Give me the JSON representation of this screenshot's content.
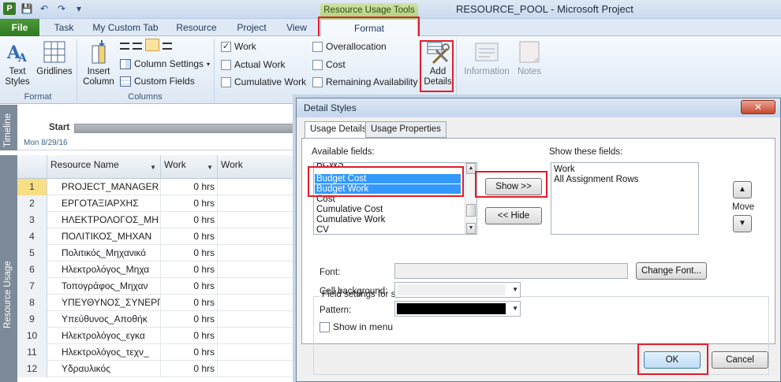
{
  "titlebar": {
    "tools_tab_title": "Resource Usage Tools",
    "app_title": "RESOURCE_POOL  -  Microsoft Project"
  },
  "tabs": [
    "File",
    "Task",
    "My Custom Tab",
    "Resource",
    "Project",
    "View",
    "Format"
  ],
  "ribbon": {
    "format_group": {
      "text_styles": "Text\nStyles",
      "gridlines": "Gridlines",
      "label": "Format"
    },
    "columns_group": {
      "insert_column": "Insert\nColumn",
      "column_settings": "Column Settings",
      "custom_fields": "Custom Fields",
      "label": "Columns"
    },
    "details": [
      {
        "label": "Work",
        "checked": true
      },
      {
        "label": "Actual Work",
        "checked": false
      },
      {
        "label": "Cumulative Work",
        "checked": false
      },
      {
        "label": "Overallocation",
        "checked": false
      },
      {
        "label": "Cost",
        "checked": false
      },
      {
        "label": "Remaining Availability",
        "checked": false
      }
    ],
    "add_details": "Add\nDetails",
    "information": "Information",
    "notes": "Notes"
  },
  "timeline": {
    "side_label": "Timeline",
    "start_label": "Start",
    "date_label": "Mon 8/29/16"
  },
  "grid": {
    "side_label": "Resource Usage",
    "columns": [
      "Resource Name",
      "Work",
      "Work"
    ],
    "rows": [
      {
        "id": "1",
        "name": "PROJECT_MANAGER",
        "work": "0 hrs"
      },
      {
        "id": "2",
        "name": "ΕΡΓΟΤΑΞΙΑΡΧΗΣ",
        "work": "0 hrs"
      },
      {
        "id": "3",
        "name": "ΗΛΕΚΤΡΟΛΟΓΟΣ_ΜΗ",
        "work": "0 hrs"
      },
      {
        "id": "4",
        "name": "ΠΟΛΙΤΙΚΟΣ_ΜΗΧΑΝ",
        "work": "0 hrs"
      },
      {
        "id": "5",
        "name": "Πολιτικός_Μηχανικό",
        "work": "0 hrs"
      },
      {
        "id": "6",
        "name": "Ηλεκτρολόγος_Μηχα",
        "work": "0 hrs"
      },
      {
        "id": "7",
        "name": "Τοπογράφος_Μηχαν",
        "work": "0 hrs"
      },
      {
        "id": "8",
        "name": "ΥΠΕΥΘΥΝΟΣ_ΣΥΝΕΡΓ",
        "work": "0 hrs"
      },
      {
        "id": "9",
        "name": "Υπεύθυνος_Αποθήκ",
        "work": "0 hrs"
      },
      {
        "id": "10",
        "name": "Ηλεκτρολόγος_εγκα",
        "work": "0 hrs"
      },
      {
        "id": "11",
        "name": "Ηλεκτρολόγος_τεχν_",
        "work": "0 hrs"
      },
      {
        "id": "12",
        "name": "Υδραυλικός",
        "work": "0 hrs"
      }
    ]
  },
  "dialog": {
    "title": "Detail Styles",
    "close": "✕",
    "tabs": [
      "Usage Details",
      "Usage Properties"
    ],
    "available_label": "Available fields:",
    "available_fields": [
      "BCWS",
      "Budget Cost",
      "Budget Work",
      "Cost",
      "Cumulative Cost",
      "Cumulative Work",
      "CV"
    ],
    "show_label": "Show these fields:",
    "shown_fields": [
      "Work",
      "All Assignment Rows"
    ],
    "show_btn": "Show >>",
    "hide_btn": "<< Hide",
    "move_label": "Move",
    "field_settings_label": "Field settings for selection",
    "font_label": "Font:",
    "change_font_btn": "Change Font...",
    "cell_background_label": "Cell background:",
    "pattern_label": "Pattern:",
    "show_in_menu_label": "Show in menu",
    "ok_btn": "OK",
    "cancel_btn": "Cancel"
  },
  "colors": {
    "highlight_box": "#e31c2a",
    "selection": "#3399ff",
    "file_tab": "#2d7a1f"
  }
}
